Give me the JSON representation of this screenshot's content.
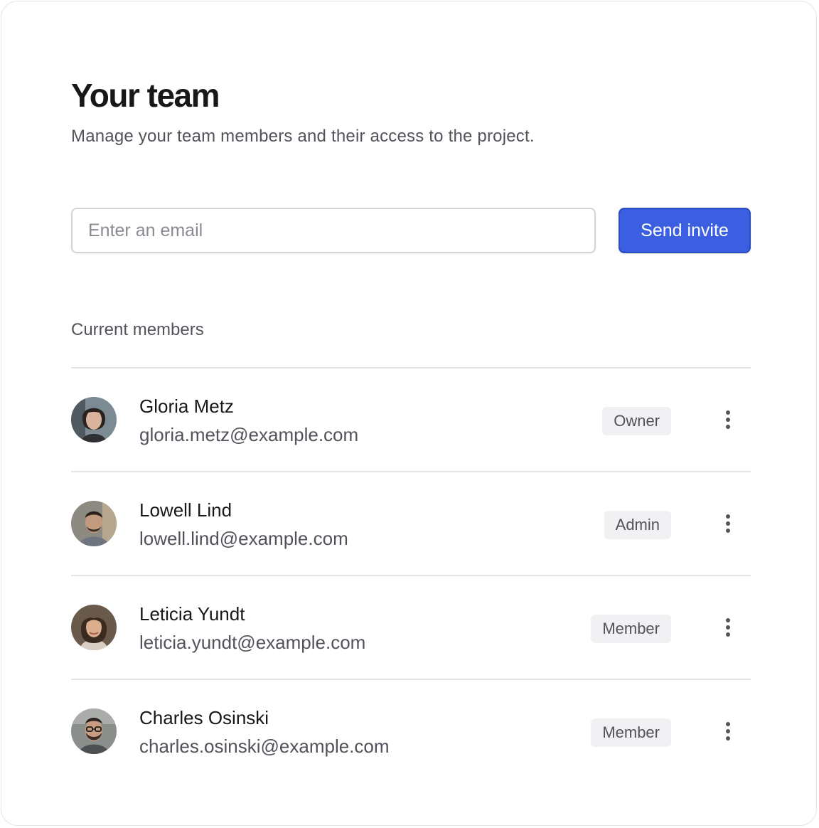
{
  "header": {
    "title": "Your team",
    "subtitle": "Manage your team members and their access to the project."
  },
  "invite": {
    "email_placeholder": "Enter an email",
    "email_value": "",
    "send_label": "Send invite"
  },
  "members_section": {
    "label": "Current members",
    "members": [
      {
        "name": "Gloria Metz",
        "email": "gloria.metz@example.com",
        "role": "Owner",
        "avatar": "avatar-photo"
      },
      {
        "name": "Lowell Lind",
        "email": "lowell.lind@example.com",
        "role": "Admin",
        "avatar": "avatar-photo"
      },
      {
        "name": "Leticia Yundt",
        "email": "leticia.yundt@example.com",
        "role": "Member",
        "avatar": "avatar-photo"
      },
      {
        "name": "Charles Osinski",
        "email": "charles.osinski@example.com",
        "role": "Member",
        "avatar": "avatar-photo"
      }
    ],
    "row_menu_icon": "more-vertical-icon"
  },
  "colors": {
    "accent": "#3b5fe0",
    "badge_bg": "#f1f1f3",
    "divider": "#e4e4e7"
  }
}
